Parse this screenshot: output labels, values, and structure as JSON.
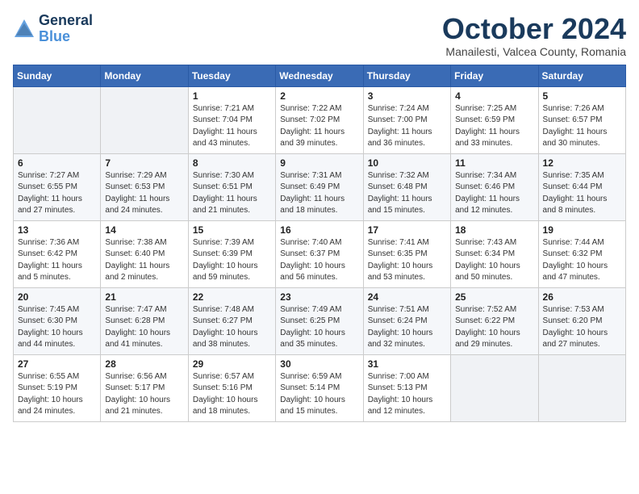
{
  "header": {
    "logo_line1": "General",
    "logo_line2": "Blue",
    "month": "October 2024",
    "location": "Manailesti, Valcea County, Romania"
  },
  "weekdays": [
    "Sunday",
    "Monday",
    "Tuesday",
    "Wednesday",
    "Thursday",
    "Friday",
    "Saturday"
  ],
  "weeks": [
    [
      {
        "day": "",
        "info": ""
      },
      {
        "day": "",
        "info": ""
      },
      {
        "day": "1",
        "info": "Sunrise: 7:21 AM\nSunset: 7:04 PM\nDaylight: 11 hours and 43 minutes."
      },
      {
        "day": "2",
        "info": "Sunrise: 7:22 AM\nSunset: 7:02 PM\nDaylight: 11 hours and 39 minutes."
      },
      {
        "day": "3",
        "info": "Sunrise: 7:24 AM\nSunset: 7:00 PM\nDaylight: 11 hours and 36 minutes."
      },
      {
        "day": "4",
        "info": "Sunrise: 7:25 AM\nSunset: 6:59 PM\nDaylight: 11 hours and 33 minutes."
      },
      {
        "day": "5",
        "info": "Sunrise: 7:26 AM\nSunset: 6:57 PM\nDaylight: 11 hours and 30 minutes."
      }
    ],
    [
      {
        "day": "6",
        "info": "Sunrise: 7:27 AM\nSunset: 6:55 PM\nDaylight: 11 hours and 27 minutes."
      },
      {
        "day": "7",
        "info": "Sunrise: 7:29 AM\nSunset: 6:53 PM\nDaylight: 11 hours and 24 minutes."
      },
      {
        "day": "8",
        "info": "Sunrise: 7:30 AM\nSunset: 6:51 PM\nDaylight: 11 hours and 21 minutes."
      },
      {
        "day": "9",
        "info": "Sunrise: 7:31 AM\nSunset: 6:49 PM\nDaylight: 11 hours and 18 minutes."
      },
      {
        "day": "10",
        "info": "Sunrise: 7:32 AM\nSunset: 6:48 PM\nDaylight: 11 hours and 15 minutes."
      },
      {
        "day": "11",
        "info": "Sunrise: 7:34 AM\nSunset: 6:46 PM\nDaylight: 11 hours and 12 minutes."
      },
      {
        "day": "12",
        "info": "Sunrise: 7:35 AM\nSunset: 6:44 PM\nDaylight: 11 hours and 8 minutes."
      }
    ],
    [
      {
        "day": "13",
        "info": "Sunrise: 7:36 AM\nSunset: 6:42 PM\nDaylight: 11 hours and 5 minutes."
      },
      {
        "day": "14",
        "info": "Sunrise: 7:38 AM\nSunset: 6:40 PM\nDaylight: 11 hours and 2 minutes."
      },
      {
        "day": "15",
        "info": "Sunrise: 7:39 AM\nSunset: 6:39 PM\nDaylight: 10 hours and 59 minutes."
      },
      {
        "day": "16",
        "info": "Sunrise: 7:40 AM\nSunset: 6:37 PM\nDaylight: 10 hours and 56 minutes."
      },
      {
        "day": "17",
        "info": "Sunrise: 7:41 AM\nSunset: 6:35 PM\nDaylight: 10 hours and 53 minutes."
      },
      {
        "day": "18",
        "info": "Sunrise: 7:43 AM\nSunset: 6:34 PM\nDaylight: 10 hours and 50 minutes."
      },
      {
        "day": "19",
        "info": "Sunrise: 7:44 AM\nSunset: 6:32 PM\nDaylight: 10 hours and 47 minutes."
      }
    ],
    [
      {
        "day": "20",
        "info": "Sunrise: 7:45 AM\nSunset: 6:30 PM\nDaylight: 10 hours and 44 minutes."
      },
      {
        "day": "21",
        "info": "Sunrise: 7:47 AM\nSunset: 6:28 PM\nDaylight: 10 hours and 41 minutes."
      },
      {
        "day": "22",
        "info": "Sunrise: 7:48 AM\nSunset: 6:27 PM\nDaylight: 10 hours and 38 minutes."
      },
      {
        "day": "23",
        "info": "Sunrise: 7:49 AM\nSunset: 6:25 PM\nDaylight: 10 hours and 35 minutes."
      },
      {
        "day": "24",
        "info": "Sunrise: 7:51 AM\nSunset: 6:24 PM\nDaylight: 10 hours and 32 minutes."
      },
      {
        "day": "25",
        "info": "Sunrise: 7:52 AM\nSunset: 6:22 PM\nDaylight: 10 hours and 29 minutes."
      },
      {
        "day": "26",
        "info": "Sunrise: 7:53 AM\nSunset: 6:20 PM\nDaylight: 10 hours and 27 minutes."
      }
    ],
    [
      {
        "day": "27",
        "info": "Sunrise: 6:55 AM\nSunset: 5:19 PM\nDaylight: 10 hours and 24 minutes."
      },
      {
        "day": "28",
        "info": "Sunrise: 6:56 AM\nSunset: 5:17 PM\nDaylight: 10 hours and 21 minutes."
      },
      {
        "day": "29",
        "info": "Sunrise: 6:57 AM\nSunset: 5:16 PM\nDaylight: 10 hours and 18 minutes."
      },
      {
        "day": "30",
        "info": "Sunrise: 6:59 AM\nSunset: 5:14 PM\nDaylight: 10 hours and 15 minutes."
      },
      {
        "day": "31",
        "info": "Sunrise: 7:00 AM\nSunset: 5:13 PM\nDaylight: 10 hours and 12 minutes."
      },
      {
        "day": "",
        "info": ""
      },
      {
        "day": "",
        "info": ""
      }
    ]
  ]
}
